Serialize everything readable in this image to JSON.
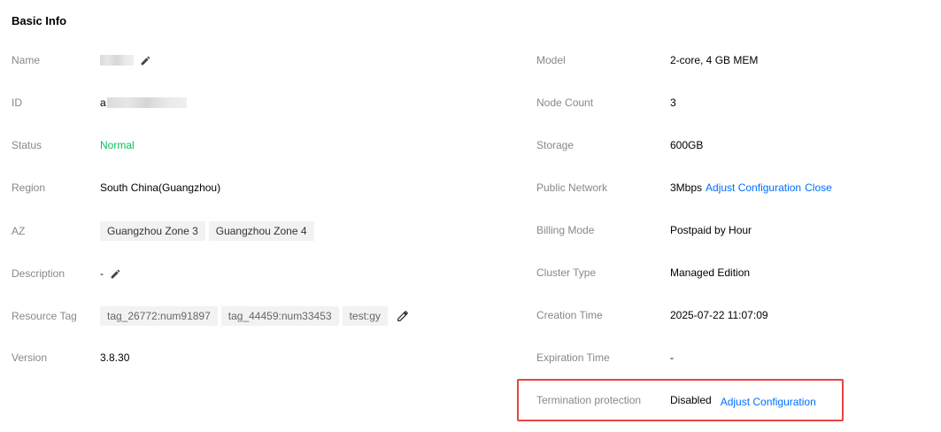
{
  "section": {
    "title": "Basic Info"
  },
  "left": {
    "name": {
      "label": "Name",
      "edit_icon": "pencil-icon"
    },
    "id": {
      "label": "ID",
      "prefix": "a"
    },
    "status": {
      "label": "Status",
      "value": "Normal",
      "color": "#0abf5b"
    },
    "region": {
      "label": "Region",
      "value": "South China(Guangzhou)"
    },
    "az": {
      "label": "AZ",
      "tags": [
        "Guangzhou Zone 3",
        "Guangzhou Zone 4"
      ]
    },
    "description": {
      "label": "Description",
      "value": "-",
      "edit_icon": "pencil-icon"
    },
    "resource_tag": {
      "label": "Resource Tag",
      "tags": [
        "tag_26772:num91897",
        "tag_44459:num33453",
        "test:gy"
      ],
      "edit_icon": "pencil-icon"
    },
    "version": {
      "label": "Version",
      "value": "3.8.30"
    }
  },
  "right": {
    "model": {
      "label": "Model",
      "value": "2-core, 4 GB MEM"
    },
    "node_count": {
      "label": "Node Count",
      "value": "3"
    },
    "storage": {
      "label": "Storage",
      "value": "600GB"
    },
    "public_network": {
      "label": "Public Network",
      "value": "3Mbps",
      "adjust_link": "Adjust Configuration",
      "close_link": "Close"
    },
    "billing_mode": {
      "label": "Billing Mode",
      "value": "Postpaid by Hour"
    },
    "cluster_type": {
      "label": "Cluster Type",
      "value": "Managed Edition"
    },
    "creation_time": {
      "label": "Creation Time",
      "value": "2025-07-22 11:07:09"
    },
    "expiration_time": {
      "label": "Expiration Time",
      "value": "-"
    },
    "termination_protection": {
      "label": "Termination protection",
      "value": "Disabled",
      "adjust_link": "Adjust Configuration"
    }
  },
  "colors": {
    "link": "#006eff",
    "label": "#888888",
    "highlight_border": "#e54545"
  }
}
